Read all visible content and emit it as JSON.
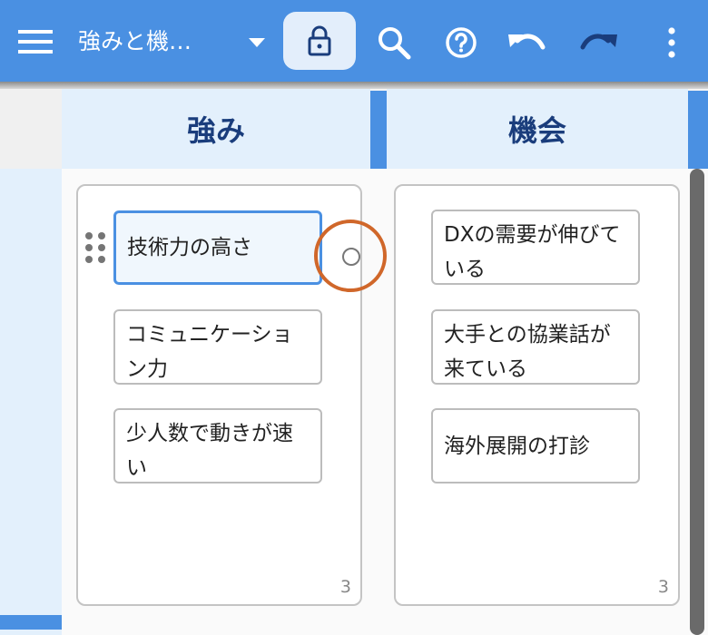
{
  "toolbar": {
    "title": "強みと機…",
    "colors": {
      "bar": "#4a90e2",
      "lock_bg": "#e3eefb",
      "icon": "#ffffff",
      "lock_icon": "#1a3d7c"
    },
    "icons": [
      "menu-icon",
      "chevron-down-icon",
      "lock-icon",
      "search-icon",
      "help-icon",
      "undo-icon",
      "redo-icon",
      "more-vertical-icon"
    ]
  },
  "columns": [
    {
      "header": "強み",
      "count": "3",
      "cards": [
        {
          "text": "技術力の高さ",
          "selected": true
        },
        {
          "text": "コミュニケーション力"
        },
        {
          "text": "少人数で動きが速い"
        }
      ]
    },
    {
      "header": "機会",
      "count": "3",
      "cards": [
        {
          "text": "DXの需要が伸びている"
        },
        {
          "text": "大手との協業話が来ている"
        },
        {
          "text": "海外展開の打診"
        }
      ]
    }
  ],
  "colors": {
    "header_bg": "#e3f0fc",
    "header_text": "#1a3d7c",
    "selected_border": "#4a90e2",
    "connector_ring": "#d0672a"
  }
}
